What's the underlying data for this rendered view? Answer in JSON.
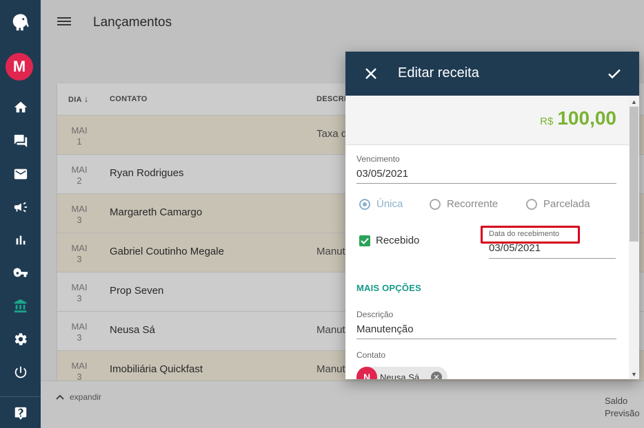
{
  "page": {
    "title": "Lançamentos"
  },
  "table": {
    "headers": {
      "day": "DIA",
      "contact": "CONTATO",
      "desc": "DESCRI"
    },
    "rows": [
      {
        "month": "MAI",
        "day": "1",
        "contact": "",
        "desc": "Taxa d",
        "tan": true
      },
      {
        "month": "MAI",
        "day": "2",
        "contact": "Ryan Rodrigues",
        "desc": "",
        "tan": false
      },
      {
        "month": "MAI",
        "day": "3",
        "contact": "Margareth Camargo",
        "desc": "",
        "tan": true
      },
      {
        "month": "MAI",
        "day": "3",
        "contact": "Gabriel Coutinho Megale",
        "desc": "Manut",
        "tan": true
      },
      {
        "month": "MAI",
        "day": "3",
        "contact": "Prop Seven",
        "desc": "",
        "tan": false
      },
      {
        "month": "MAI",
        "day": "3",
        "contact": "Neusa Sá",
        "desc": "Manut",
        "tan": false
      },
      {
        "month": "MAI",
        "day": "3",
        "contact": "Imobiliária Quickfast",
        "desc": "Manut",
        "tan": true
      }
    ]
  },
  "bottom": {
    "expand": "expandir",
    "saldo": "Saldo",
    "previsao": "Previsão"
  },
  "dialog": {
    "title": "Editar receita",
    "currency": "R$",
    "amount": "100,00",
    "vencimento_label": "Vencimento",
    "vencimento_value": "03/05/2021",
    "radio_unica": "Única",
    "radio_recorrente": "Recorrente",
    "radio_parcelada": "Parcelada",
    "recebido_label": "Recebido",
    "recebimento_label": "Data do recebimento",
    "recebimento_value": "03/05/2021",
    "mais_opcoes": "MAIS OPÇÕES",
    "descricao_label": "Descrição",
    "descricao_value": "Manutenção",
    "contato_label": "Contato",
    "contato_initial": "N",
    "contato_name": "Neusa Sá"
  },
  "sidebar": {
    "avatar_initial": "M"
  },
  "colors": {
    "sidebar": "#1f3b52",
    "accent_green": "#7ab332",
    "teal": "#16998a",
    "highlight": "#d4001a"
  }
}
